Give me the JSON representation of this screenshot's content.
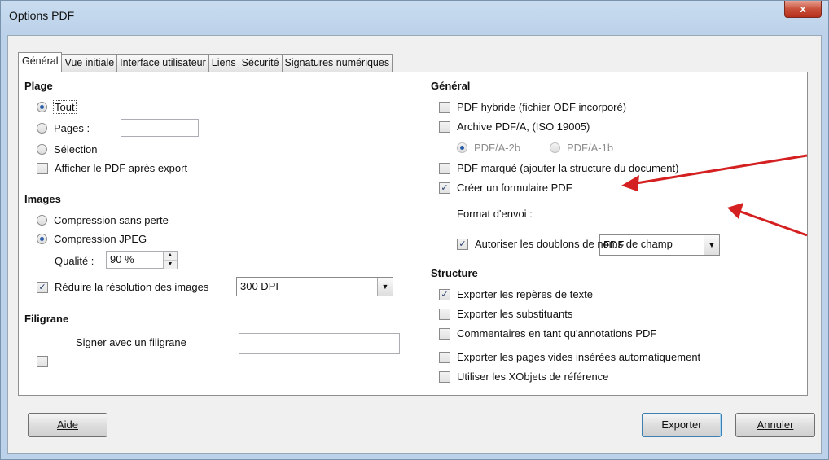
{
  "window": {
    "title": "Options PDF",
    "close": "x"
  },
  "tabs": [
    "Général",
    "Vue initiale",
    "Interface utilisateur",
    "Liens",
    "Sécurité",
    "Signatures numériques"
  ],
  "left": {
    "plage": {
      "heading": "Plage",
      "tout": "Tout",
      "pages": "Pages :",
      "pages_value": "",
      "selection": "Sélection",
      "afficher": "Afficher le PDF après export"
    },
    "images": {
      "heading": "Images",
      "sans_perte": "Compression sans perte",
      "jpeg": "Compression JPEG",
      "qualite_label": "Qualité :",
      "qualite_value": "90 %",
      "reduire": "Réduire la résolution des images",
      "dpi_value": "300 DPI"
    },
    "filigrane": {
      "heading": "Filigrane",
      "signer": "Signer avec un filigrane",
      "signer_value": ""
    }
  },
  "right": {
    "general": {
      "heading": "Général",
      "hybride": "PDF hybride (fichier ODF incorporé)",
      "archive": "Archive PDF/A, (ISO 19005)",
      "pdfa2b": "PDF/A-2b",
      "pdfa1b": "PDF/A-1b",
      "marque": "PDF marqué (ajouter la structure du document)",
      "formulaire": "Créer un formulaire PDF",
      "format_label": "Format d'envoi :",
      "format_value": "FDF",
      "doublons": "Autoriser les doublons de noms de champ"
    },
    "structure": {
      "heading": "Structure",
      "reperes": "Exporter les repères de texte",
      "substituants": "Exporter les substituants",
      "commentaires": "Commentaires en tant qu'annotations PDF",
      "pages_vides": "Exporter les pages vides insérées automatiquement",
      "xobjets": "Utiliser les XObjets de référence"
    }
  },
  "buttons": {
    "aide": "Aide",
    "exporter": "Exporter",
    "annuler": "Annuler"
  },
  "colors": {
    "annotation_arrow": "#d42020",
    "radio_dot": "#2b5da8"
  }
}
